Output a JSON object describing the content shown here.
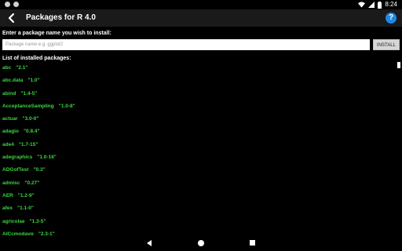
{
  "status": {
    "time": "8:24"
  },
  "appbar": {
    "title": "Packages for R 4.0",
    "help_label": "?"
  },
  "install": {
    "prompt": "Enter a package name you wish to install:",
    "placeholder": "Package name e.g. ggplot2",
    "button_label": "INSTALL"
  },
  "installed": {
    "header": "List of installed packages:",
    "packages": [
      {
        "name": "abc",
        "version": "\"2.1\""
      },
      {
        "name": "abc.data",
        "version": "\"1.0\""
      },
      {
        "name": "abind",
        "version": "\"1.4-5\""
      },
      {
        "name": "AcceptanceSampling",
        "version": "\"1.0-8\""
      },
      {
        "name": "actuar",
        "version": "\"3.0-0\""
      },
      {
        "name": "adagio",
        "version": "\"0.8.4\""
      },
      {
        "name": "ade4",
        "version": "\"1.7-15\""
      },
      {
        "name": "adegraphics",
        "version": "\"1.0-16\""
      },
      {
        "name": "ADGofTest",
        "version": "\"0.3\""
      },
      {
        "name": "admisc",
        "version": "\"0.27\""
      },
      {
        "name": "AER",
        "version": "\"1.2-9\""
      },
      {
        "name": "afex",
        "version": "\"1.1-0\""
      },
      {
        "name": "agricolae",
        "version": "\"1.3-5\""
      },
      {
        "name": "AICcmodavg",
        "version": "\"2.3-1\""
      }
    ]
  },
  "colors": {
    "accent": "#1e88e5",
    "package_text": "#3ed43e",
    "appbar_bg": "#1a1a1a"
  }
}
